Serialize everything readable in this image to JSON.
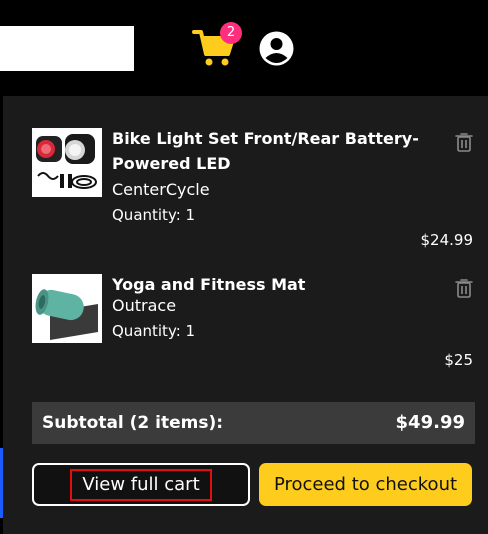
{
  "header": {
    "cart_count": "2",
    "cart_icon": "shopping-cart-icon",
    "user_icon": "account-circle-icon",
    "accent_color": "#fecc1d",
    "badge_color": "#ff2e7e"
  },
  "cart": {
    "items": [
      {
        "title": "Bike Light Set Front/Rear Battery-Powered LED",
        "brand": "CenterCycle",
        "quantity": "Quantity: 1",
        "price": "$24.99",
        "thumbnail": "bike-lights-image",
        "remove_icon": "trash-icon"
      },
      {
        "title": "Yoga and Fitness Mat",
        "brand": "Outrace",
        "quantity": "Quantity: 1",
        "price": "$25",
        "thumbnail": "yoga-mat-image",
        "remove_icon": "trash-icon"
      }
    ],
    "subtotal_label": "Subtotal (2 items):",
    "subtotal_value": "$49.99",
    "view_cart_label": "View full cart",
    "checkout_label": "Proceed to checkout"
  }
}
